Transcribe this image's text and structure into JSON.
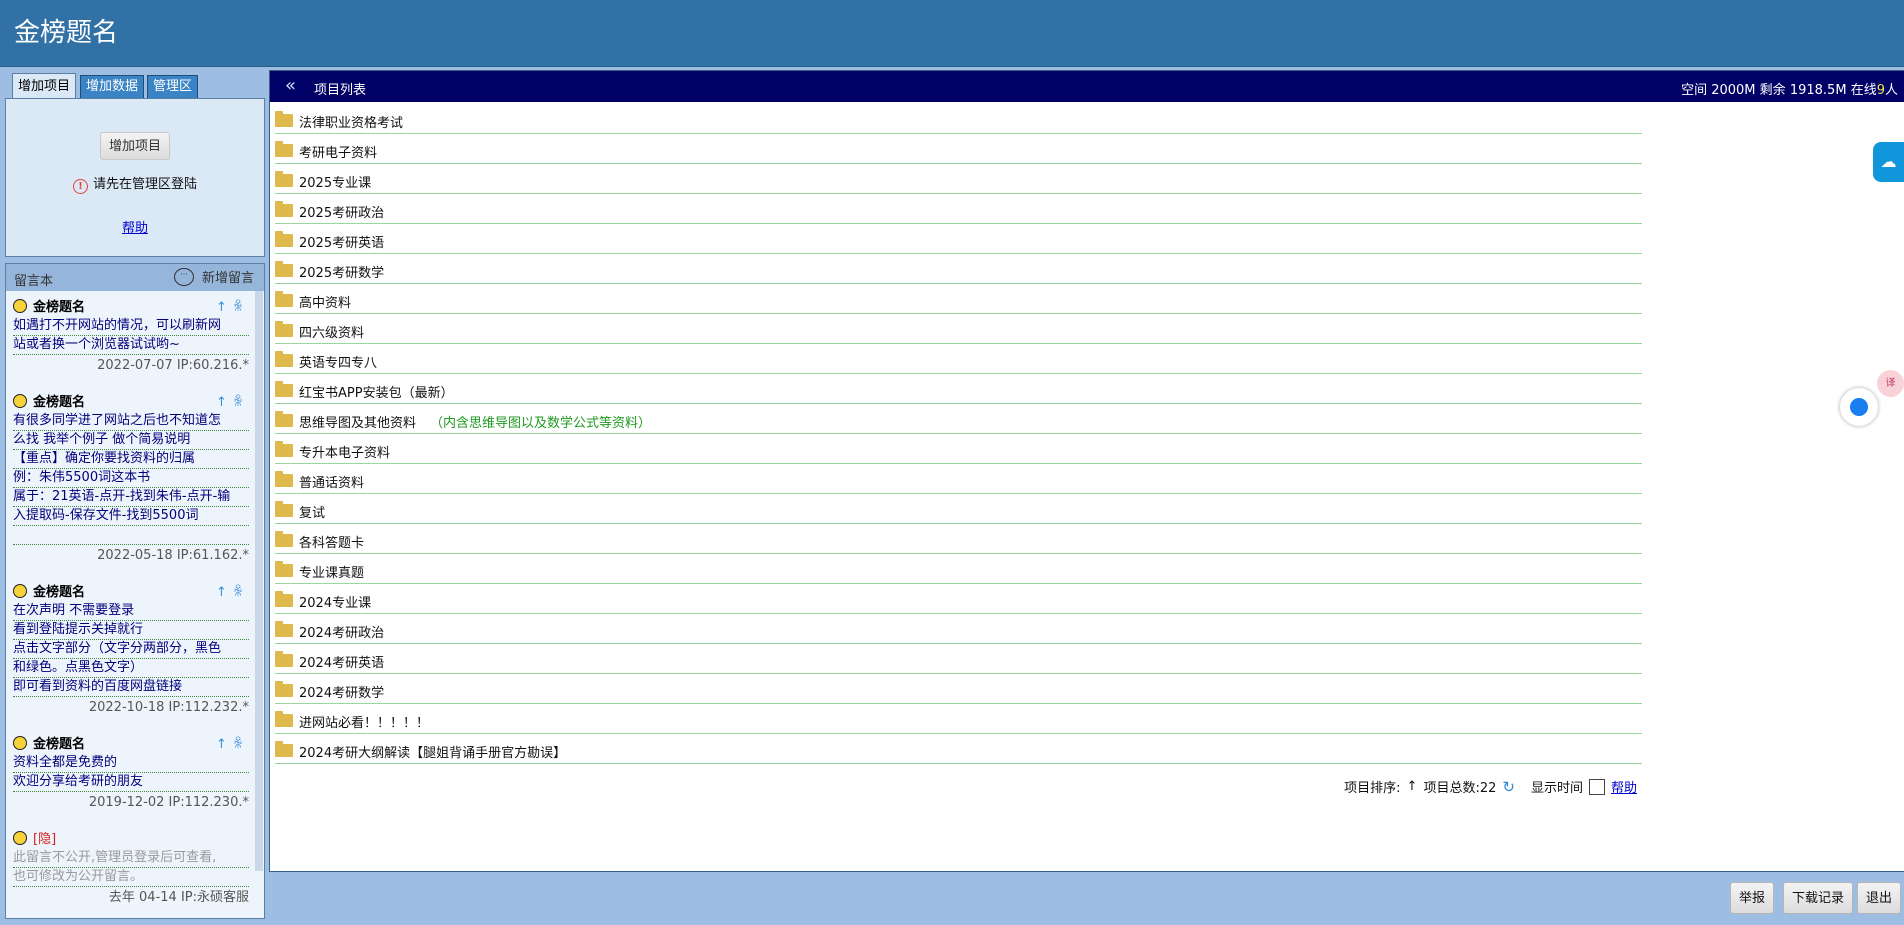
{
  "site": {
    "title": "金榜题名"
  },
  "tabs": [
    {
      "label": "增加项目"
    },
    {
      "label": "增加数据"
    },
    {
      "label": "管理区"
    }
  ],
  "add_panel": {
    "button": "增加项目",
    "login_msg": "请先在管理区登陆",
    "help": "帮助"
  },
  "guestbook": {
    "title": "留言本",
    "new_label": "新增留言",
    "entries": [
      {
        "name": "金榜题名",
        "lines": [
          "如遇打不开网站的情况，可以刷新网",
          "站或者换一个浏览器试试哟~"
        ],
        "meta": "2022-07-07 IP:60.216.*"
      },
      {
        "name": "金榜题名",
        "lines": [
          "有很多同学进了网站之后也不知道怎",
          "么找 我举个例子 做个简易说明",
          "【重点】确定你要找资料的归属",
          "例：朱伟5500词这本书",
          "属于：21英语-点开-找到朱伟-点开-输",
          "入提取码-保存文件-找到5500词",
          ""
        ],
        "meta": "2022-05-18 IP:61.162.*"
      },
      {
        "name": "金榜题名",
        "lines": [
          "在次声明 不需要登录",
          "看到登陆提示关掉就行",
          "点击文字部分（文字分两部分，黑色",
          "和绿色。点黑色文字）",
          "即可看到资料的百度网盘链接"
        ],
        "meta": "2022-10-18 IP:112.232.*"
      },
      {
        "name": "金榜题名",
        "lines": [
          "资料全都是免费的",
          "欢迎分享给考研的朋友"
        ],
        "meta": "2019-12-02 IP:112.230.*"
      },
      {
        "tag": "[隐]",
        "lines": [
          "此留言不公开,管理员登录后可查看,",
          "也可修改为公开留言。"
        ],
        "meta": "去年 04-14 IP:永硕客服"
      }
    ]
  },
  "main": {
    "title": "项目列表",
    "stats": {
      "space_label": "空间",
      "space": "2000M",
      "remain_label": "剩余",
      "remain": "1918.5M",
      "online_label": "在线",
      "online": "9",
      "online_unit": "人"
    },
    "items": [
      {
        "name": "法律职业资格考试"
      },
      {
        "name": "考研电子资料"
      },
      {
        "name": "2025专业课"
      },
      {
        "name": "2025考研政治"
      },
      {
        "name": "2025考研英语"
      },
      {
        "name": "2025考研数学"
      },
      {
        "name": "高中资料"
      },
      {
        "name": "四六级资料"
      },
      {
        "name": "英语专四专八"
      },
      {
        "name": "红宝书APP安装包（最新）"
      },
      {
        "name": "思维导图及其他资料",
        "note": "（内含思维导图以及数学公式等资料）"
      },
      {
        "name": "专升本电子资料"
      },
      {
        "name": "普通话资料"
      },
      {
        "name": "复试"
      },
      {
        "name": "各科答题卡"
      },
      {
        "name": "专业课真题"
      },
      {
        "name": "2024专业课"
      },
      {
        "name": "2024考研政治"
      },
      {
        "name": "2024考研英语"
      },
      {
        "name": "2024考研数学"
      },
      {
        "name": "进网站必看！！！！！"
      },
      {
        "name": "2024考研大纲解读【腿姐背诵手册官方勘误】"
      }
    ],
    "footer": {
      "sort_label": "项目排序:",
      "sort_arrow": "↑",
      "total_label": "项目总数:22",
      "show_time": "显示时间",
      "help": "帮助"
    }
  },
  "bottom": {
    "report": "举报",
    "download_log": "下载记录",
    "exit": "退出"
  }
}
